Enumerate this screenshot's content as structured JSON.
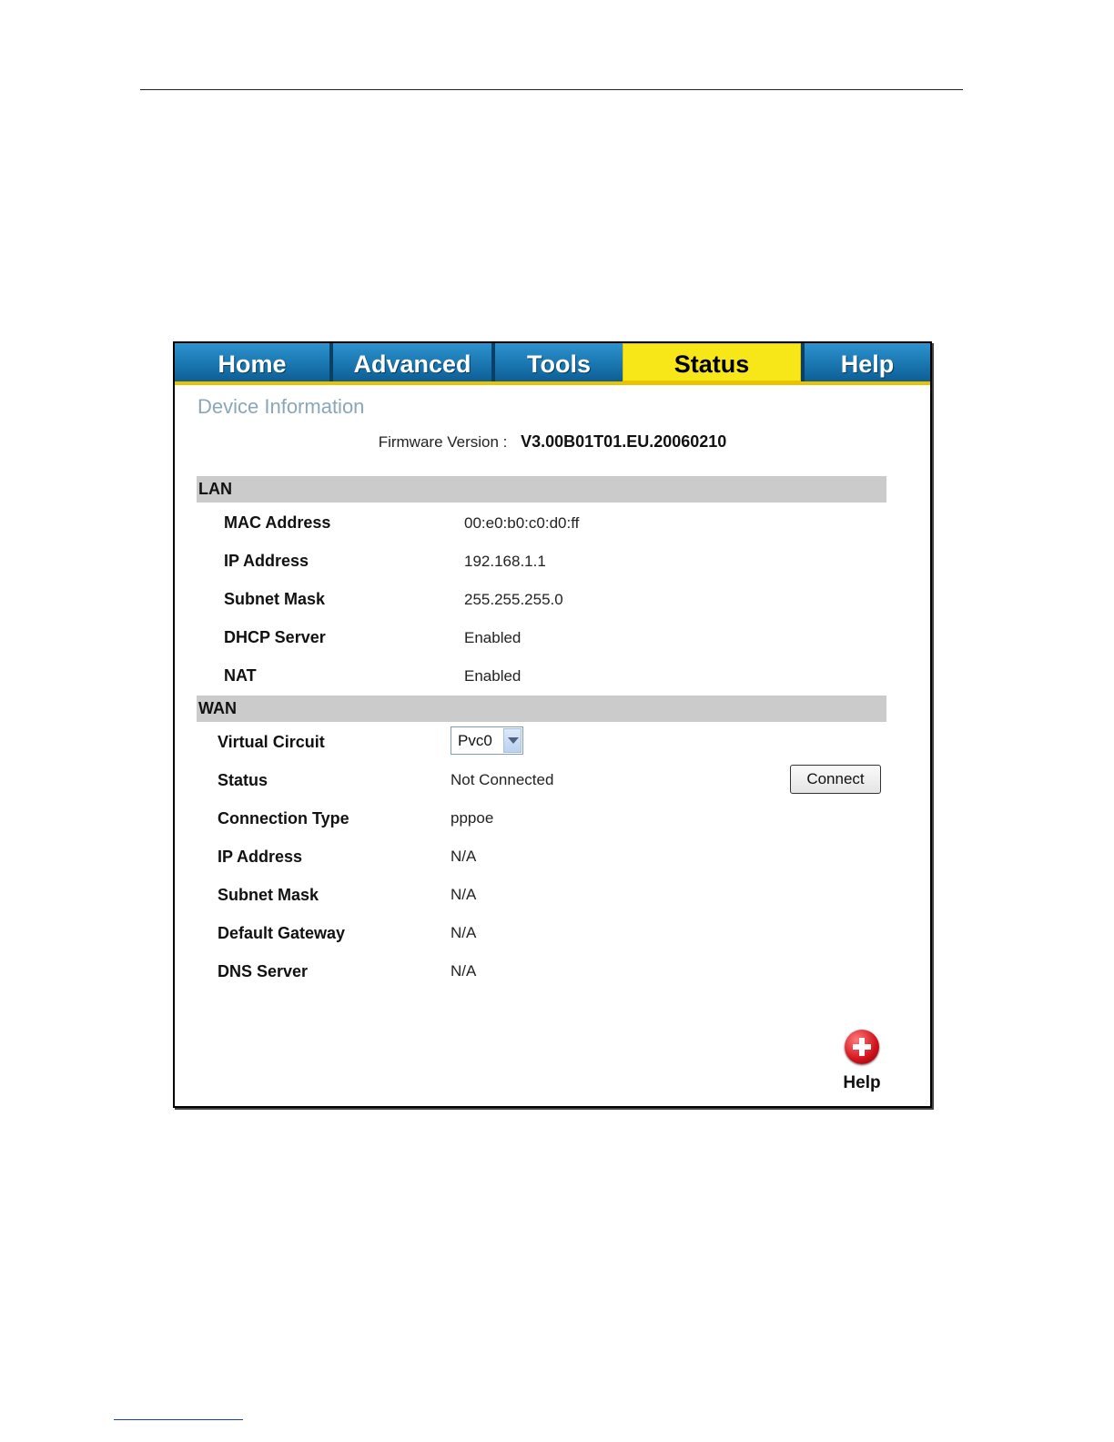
{
  "tabs": [
    {
      "label": "Home"
    },
    {
      "label": "Advanced"
    },
    {
      "label": "Tools"
    },
    {
      "label": "Status",
      "active": true
    },
    {
      "label": "Help"
    }
  ],
  "page_title": "Device Information",
  "firmware": {
    "label": "Firmware Version :",
    "value": "V3.00B01T01.EU.20060210"
  },
  "lan": {
    "header": "LAN",
    "rows": [
      {
        "label": "MAC Address",
        "value": "00:e0:b0:c0:d0:ff"
      },
      {
        "label": "IP Address",
        "value": "192.168.1.1"
      },
      {
        "label": "Subnet Mask",
        "value": "255.255.255.0"
      },
      {
        "label": "DHCP Server",
        "value": "Enabled"
      },
      {
        "label": "NAT",
        "value": "Enabled"
      }
    ]
  },
  "wan": {
    "header": "WAN",
    "virtual_circuit": {
      "label": "Virtual Circuit",
      "selected": "Pvc0"
    },
    "status": {
      "label": "Status",
      "value": "Not Connected",
      "button": "Connect"
    },
    "rows": [
      {
        "label": "Connection Type",
        "value": "pppoe"
      },
      {
        "label": "IP Address",
        "value": "N/A"
      },
      {
        "label": "Subnet Mask",
        "value": "N/A"
      },
      {
        "label": "Default Gateway",
        "value": "N/A"
      },
      {
        "label": "DNS Server",
        "value": "N/A"
      }
    ]
  },
  "help": {
    "label": "Help",
    "icon": "plus-circle-icon"
  },
  "colors": {
    "tab_bar": "#0d5e95",
    "active_tab": "#f7e618",
    "band": "#cbcbcb"
  }
}
